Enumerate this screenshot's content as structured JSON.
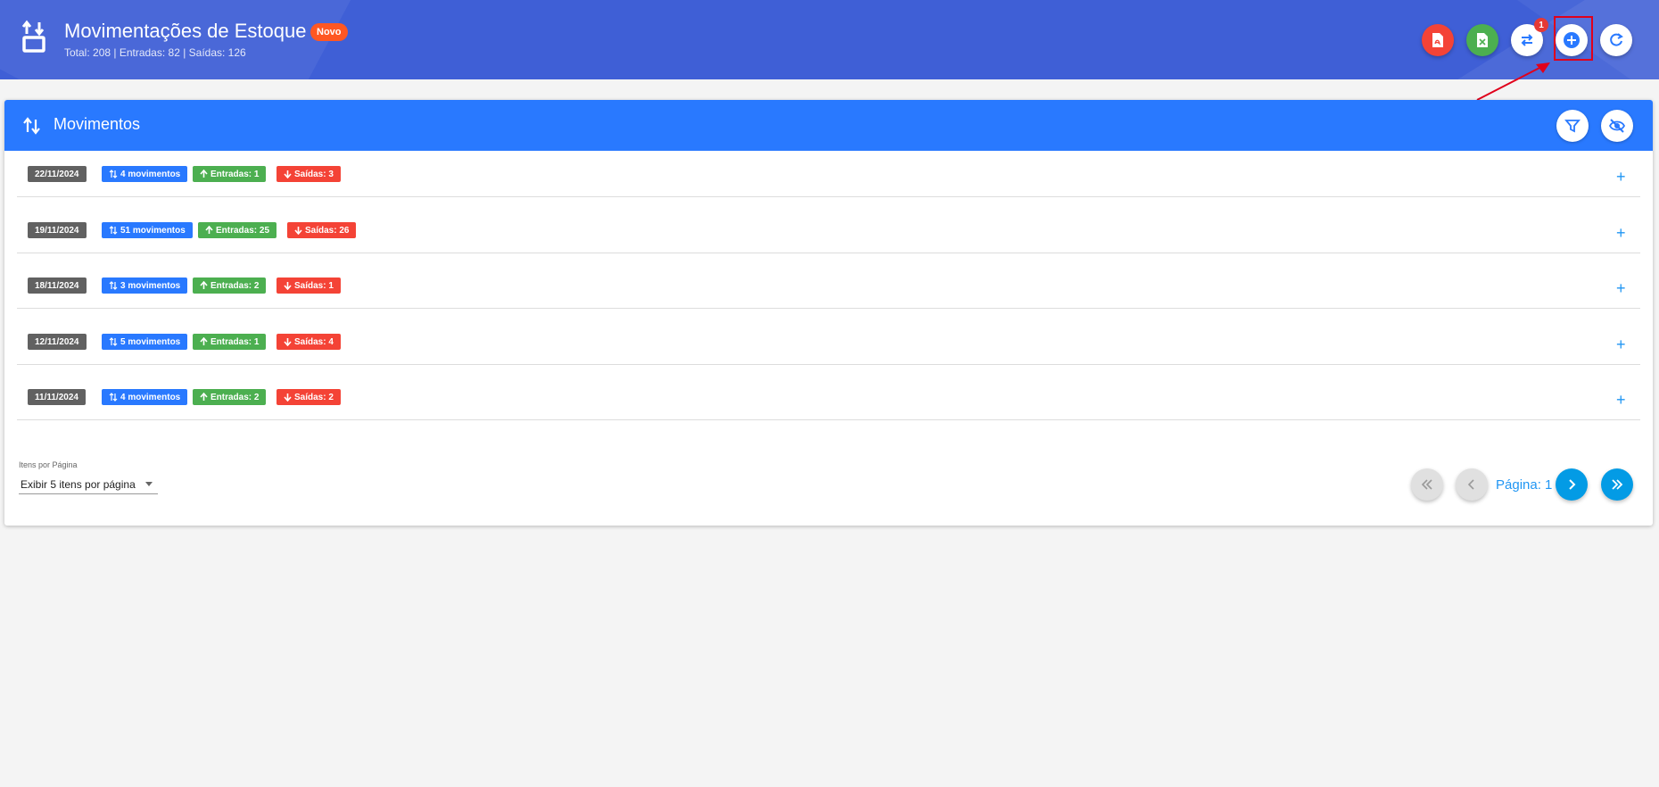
{
  "header": {
    "title": "Movimentações de Estoque",
    "badge": "Novo",
    "subtitle": "Total: 208 | Entradas: 82 | Saídas: 126",
    "icon": "swap-vertical-box-icon",
    "notification_count": "1",
    "actions": [
      "pdf-export-icon",
      "excel-export-icon",
      "swap-horizontal-icon",
      "add-circle-icon",
      "refresh-icon"
    ]
  },
  "card": {
    "title": "Movimentos",
    "icon": "swap-vertical-icon",
    "actions": [
      "filter-icon",
      "eye-off-icon"
    ]
  },
  "rows": [
    {
      "date": "22/11/2024",
      "movimentos": "4 movimentos",
      "entradas": "Entradas: 1",
      "saidas": "Saídas: 3"
    },
    {
      "date": "19/11/2024",
      "movimentos": "51 movimentos",
      "entradas": "Entradas: 25",
      "saidas": "Saídas: 26"
    },
    {
      "date": "18/11/2024",
      "movimentos": "3 movimentos",
      "entradas": "Entradas: 2",
      "saidas": "Saídas: 1"
    },
    {
      "date": "12/11/2024",
      "movimentos": "5 movimentos",
      "entradas": "Entradas: 1",
      "saidas": "Saídas: 4"
    },
    {
      "date": "11/11/2024",
      "movimentos": "4 movimentos",
      "entradas": "Entradas: 2",
      "saidas": "Saídas: 2"
    }
  ],
  "pagination": {
    "items_label": "Itens por Página",
    "items_value": "Exibir 5 itens por página",
    "page_label": "Página: 1"
  },
  "colors": {
    "header_bg": "#3f5fd6",
    "card_header_bg": "#2979ff",
    "date_chip": "#616161",
    "mov_chip": "#2979ff",
    "ent_chip": "#4caf50",
    "sai_chip": "#f44336",
    "highlight": "#e0001b"
  }
}
